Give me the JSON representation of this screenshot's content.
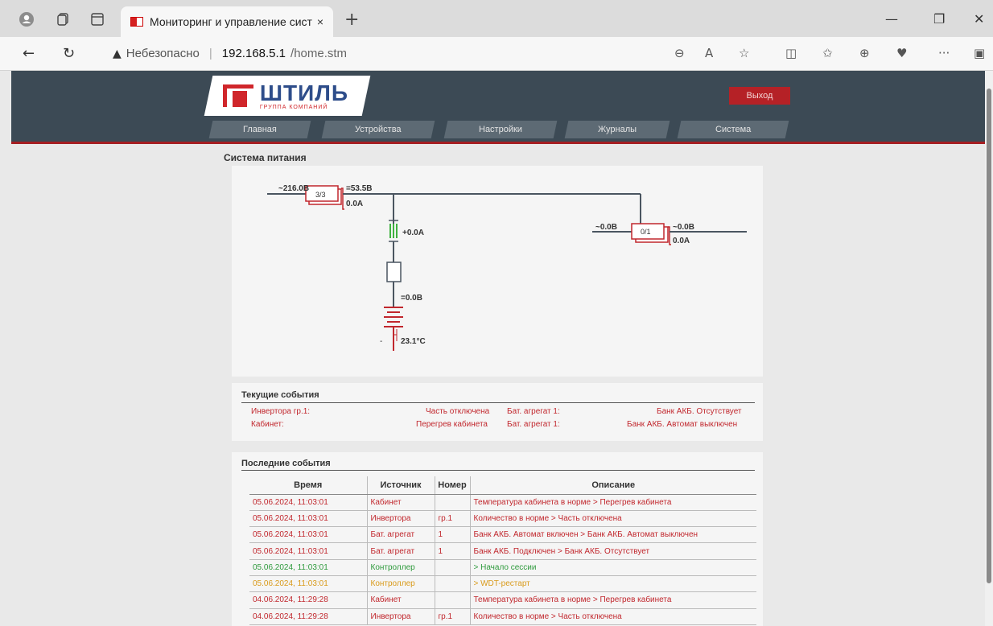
{
  "browser": {
    "tab_title": "Мониторинг и управление сист",
    "tab_close": "×",
    "new_tab": "+",
    "insecure_label": "Небезопасно",
    "url_host": "192.168.5.1",
    "url_path": "/home.stm",
    "more": "···"
  },
  "header": {
    "logo_text": "ШТИЛЬ",
    "logo_subtext": "ГРУППА КОМПАНИЙ",
    "exit_label": "Выход",
    "menu": [
      {
        "label": "Главная"
      },
      {
        "label": "Устройства"
      },
      {
        "label": "Настройки"
      },
      {
        "label": "Журналы"
      },
      {
        "label": "Система"
      }
    ]
  },
  "power": {
    "title": "Система питания",
    "ac_in": "~216.0В",
    "rect_count": "3/3",
    "dc_out_v": "=53.5В",
    "dc_out_a": "0.0A",
    "battery_current": "+0.0A",
    "battery_voltage": "=0.0В",
    "battery_minus": "-",
    "battery_temp": "23.1°C",
    "inv_in": "~0.0В",
    "inv_count": "0/1",
    "inv_out_v": "~0.0В",
    "inv_out_a": "0.0A"
  },
  "current_events": {
    "title": "Текущие события",
    "rows": [
      {
        "source": "Инвертора гр.1:",
        "state": "Часть отключена",
        "source2": "Бат. агрегат 1:",
        "state2": "Банк АКБ. Отсутствует"
      },
      {
        "source": "Кабинет:",
        "state": "Перегрев кабинета",
        "source2": "Бат. агрегат 1:",
        "state2": "Банк АКБ. Автомат выключен"
      }
    ]
  },
  "last_events": {
    "title": "Последние события",
    "headers": {
      "time": "Время",
      "source": "Источник",
      "number": "Номер",
      "description": "Описание"
    },
    "rows": [
      {
        "time": "05.06.2024, 11:03:01",
        "source": "Кабинет",
        "number": "",
        "description": "Температура кабинета в норме > Перегрев кабинета",
        "color": "red"
      },
      {
        "time": "05.06.2024, 11:03:01",
        "source": "Инвертора",
        "number": "гр.1",
        "description": "Количество в норме > Часть отключена",
        "color": "red"
      },
      {
        "time": "05.06.2024, 11:03:01",
        "source": "Бат. агрегат",
        "number": "1",
        "description": "Банк АКБ. Автомат включен > Банк АКБ. Автомат выключен",
        "color": "red"
      },
      {
        "time": "05.06.2024, 11:03:01",
        "source": "Бат. агрегат",
        "number": "1",
        "description": "Банк АКБ. Подключен > Банк АКБ. Отсутствует",
        "color": "red"
      },
      {
        "time": "05.06.2024, 11:03:01",
        "source": "Контроллер",
        "number": "",
        "description": "> Начало сессии",
        "color": "green"
      },
      {
        "time": "05.06.2024, 11:03:01",
        "source": "Контроллер",
        "number": "",
        "description": "> WDT-рестарт",
        "color": "yellow"
      },
      {
        "time": "04.06.2024, 11:29:28",
        "source": "Кабинет",
        "number": "",
        "description": "Температура кабинета в норме > Перегрев кабинета",
        "color": "red"
      },
      {
        "time": "04.06.2024, 11:29:28",
        "source": "Инвертора",
        "number": "гр.1",
        "description": "Количество в норме > Часть отключена",
        "color": "red"
      }
    ]
  },
  "colors": {
    "accent": "#c1272d",
    "header": "#3c4a55",
    "green": "#2e9a3c",
    "yellow": "#d99a1a"
  }
}
